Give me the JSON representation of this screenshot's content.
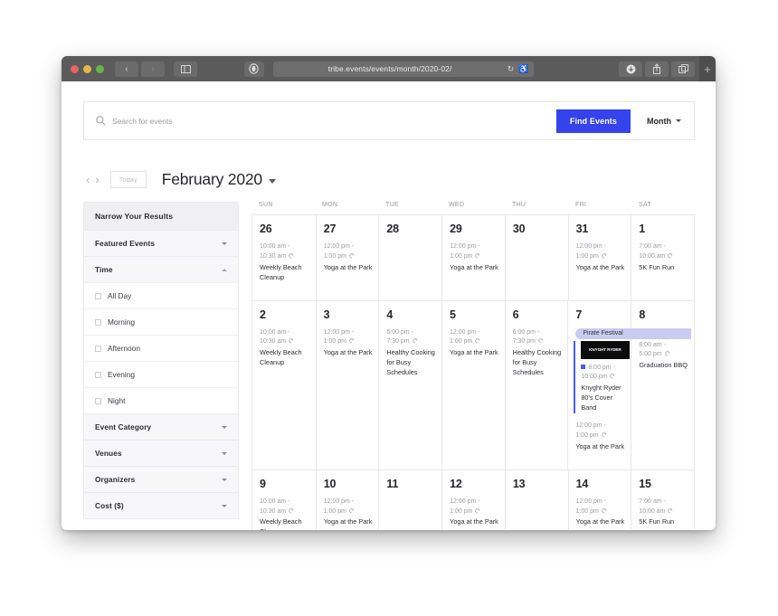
{
  "browser": {
    "url": "tribe.events/events/month/2020-02/",
    "reload_icon": "reload-icon",
    "reader_icon": "reader-icon",
    "shield_icon": "privacy-shield-icon",
    "back_icon": "‹",
    "forward_icon": "›",
    "sidebar_icon": "sidebar-icon",
    "download_icon": "download-icon",
    "share_icon": "share-icon",
    "tabs_icon": "tab-overview-icon",
    "new_tab_icon": "+"
  },
  "search": {
    "placeholder": "Search for events",
    "value": "",
    "find_events_label": "Find Events",
    "view_label": "Month"
  },
  "monthnav": {
    "prev_label": "‹",
    "next_label": "›",
    "today_label": "Today",
    "title": "February 2020"
  },
  "filters": {
    "header": "Narrow Your Results",
    "groups": [
      {
        "label": "Featured Events",
        "state": "collapsed"
      },
      {
        "label": "Time",
        "state": "expanded"
      },
      {
        "label": "Event Category",
        "state": "collapsed"
      },
      {
        "label": "Venues",
        "state": "collapsed"
      },
      {
        "label": "Organizers",
        "state": "collapsed"
      },
      {
        "label": "Cost ($)",
        "state": "collapsed"
      }
    ],
    "time_options": [
      {
        "label": "All Day",
        "checked": false
      },
      {
        "label": "Morning",
        "checked": false
      },
      {
        "label": "Afternoon",
        "checked": false
      },
      {
        "label": "Evening",
        "checked": false
      },
      {
        "label": "Night",
        "checked": false
      }
    ]
  },
  "calendar": {
    "weekdays": [
      "SUN",
      "MON",
      "TUE",
      "WED",
      "THU",
      "FRI",
      "SAT"
    ],
    "spanning_event": {
      "label": "Pirate Festival",
      "start_day": "7",
      "color": "#c9cbf0"
    },
    "weeks": [
      {
        "days": [
          {
            "num": "26",
            "events": [
              {
                "time_start": "10:00 am -",
                "time_end": "10:30 am",
                "recurring": true,
                "title": "Weekly Beach Cleanup"
              }
            ]
          },
          {
            "num": "27",
            "events": [
              {
                "time_start": "12:00 pm -",
                "time_end": "1:00 pm",
                "recurring": true,
                "title": "Yoga at the Park"
              }
            ]
          },
          {
            "num": "28",
            "events": []
          },
          {
            "num": "29",
            "events": [
              {
                "time_start": "12:00 pm -",
                "time_end": "1:00 pm",
                "recurring": true,
                "title": "Yoga at the Park"
              }
            ]
          },
          {
            "num": "30",
            "events": []
          },
          {
            "num": "31",
            "events": [
              {
                "time_start": "12:00 pm -",
                "time_end": "1:00 pm",
                "recurring": true,
                "title": "Yoga at the Park"
              }
            ]
          },
          {
            "num": "1",
            "events": [
              {
                "time_start": "7:00 am -",
                "time_end": "10:00 am",
                "recurring": true,
                "title": "5K Fun Run"
              }
            ]
          }
        ]
      },
      {
        "days": [
          {
            "num": "2",
            "events": [
              {
                "time_start": "10:00 am -",
                "time_end": "10:30 am",
                "recurring": true,
                "title": "Weekly Beach Cleanup"
              }
            ]
          },
          {
            "num": "3",
            "events": [
              {
                "time_start": "12:00 pm -",
                "time_end": "1:00 pm",
                "recurring": true,
                "title": "Yoga at the Park"
              }
            ]
          },
          {
            "num": "4",
            "events": [
              {
                "time_start": "6:00 pm -",
                "time_end": "7:30 pm",
                "recurring": true,
                "title": "Healthy Cooking for Busy Schedules"
              }
            ]
          },
          {
            "num": "5",
            "events": [
              {
                "time_start": "12:00 pm -",
                "time_end": "1:00 pm",
                "recurring": true,
                "title": "Yoga at the Park"
              }
            ]
          },
          {
            "num": "6",
            "events": [
              {
                "time_start": "6:00 pm -",
                "time_end": "7:30 pm",
                "recurring": true,
                "title": "Healthy Cooking for Busy Schedules"
              }
            ]
          },
          {
            "num": "7",
            "events": [
              {
                "time_start": "8:00 pm -",
                "time_end": "10:00 pm",
                "recurring": true,
                "title": "Knyght Ryder 80's Cover Band",
                "featured": true,
                "thumb_text": "KNYGHT RYDER"
              },
              {
                "time_start": "12:00 pm -",
                "time_end": "1:00 pm",
                "recurring": true,
                "title": "Yoga at the Park"
              }
            ]
          },
          {
            "num": "8",
            "events": [
              {
                "time_start": "8:00 am -",
                "time_end": "5:00 pm",
                "recurring": true,
                "title": "Graduation BBQ"
              }
            ]
          }
        ]
      },
      {
        "days": [
          {
            "num": "9",
            "events": [
              {
                "time_start": "10:00 am -",
                "time_end": "10:30 am",
                "recurring": true,
                "title": "Weekly Beach Cleanup"
              }
            ]
          },
          {
            "num": "10",
            "events": [
              {
                "time_start": "12:00 pm -",
                "time_end": "1:00 pm",
                "recurring": true,
                "title": "Yoga at the Park"
              }
            ]
          },
          {
            "num": "11",
            "events": []
          },
          {
            "num": "12",
            "events": [
              {
                "time_start": "12:00 pm -",
                "time_end": "1:00 pm",
                "recurring": true,
                "title": "Yoga at the Park"
              }
            ]
          },
          {
            "num": "13",
            "events": []
          },
          {
            "num": "14",
            "events": [
              {
                "time_start": "12:00 pm -",
                "time_end": "1:00 pm",
                "recurring": true,
                "title": "Yoga at the Park"
              }
            ]
          },
          {
            "num": "15",
            "events": [
              {
                "time_start": "7:00 am -",
                "time_end": "10:00 am",
                "recurring": true,
                "title": "5K Fun Run"
              }
            ]
          }
        ]
      }
    ]
  },
  "colors": {
    "accent_blue": "#3543ec",
    "featured_bar": "#4a5bf0",
    "span_bar": "#c9cbf0",
    "titlebar": "#5b5b5b"
  }
}
